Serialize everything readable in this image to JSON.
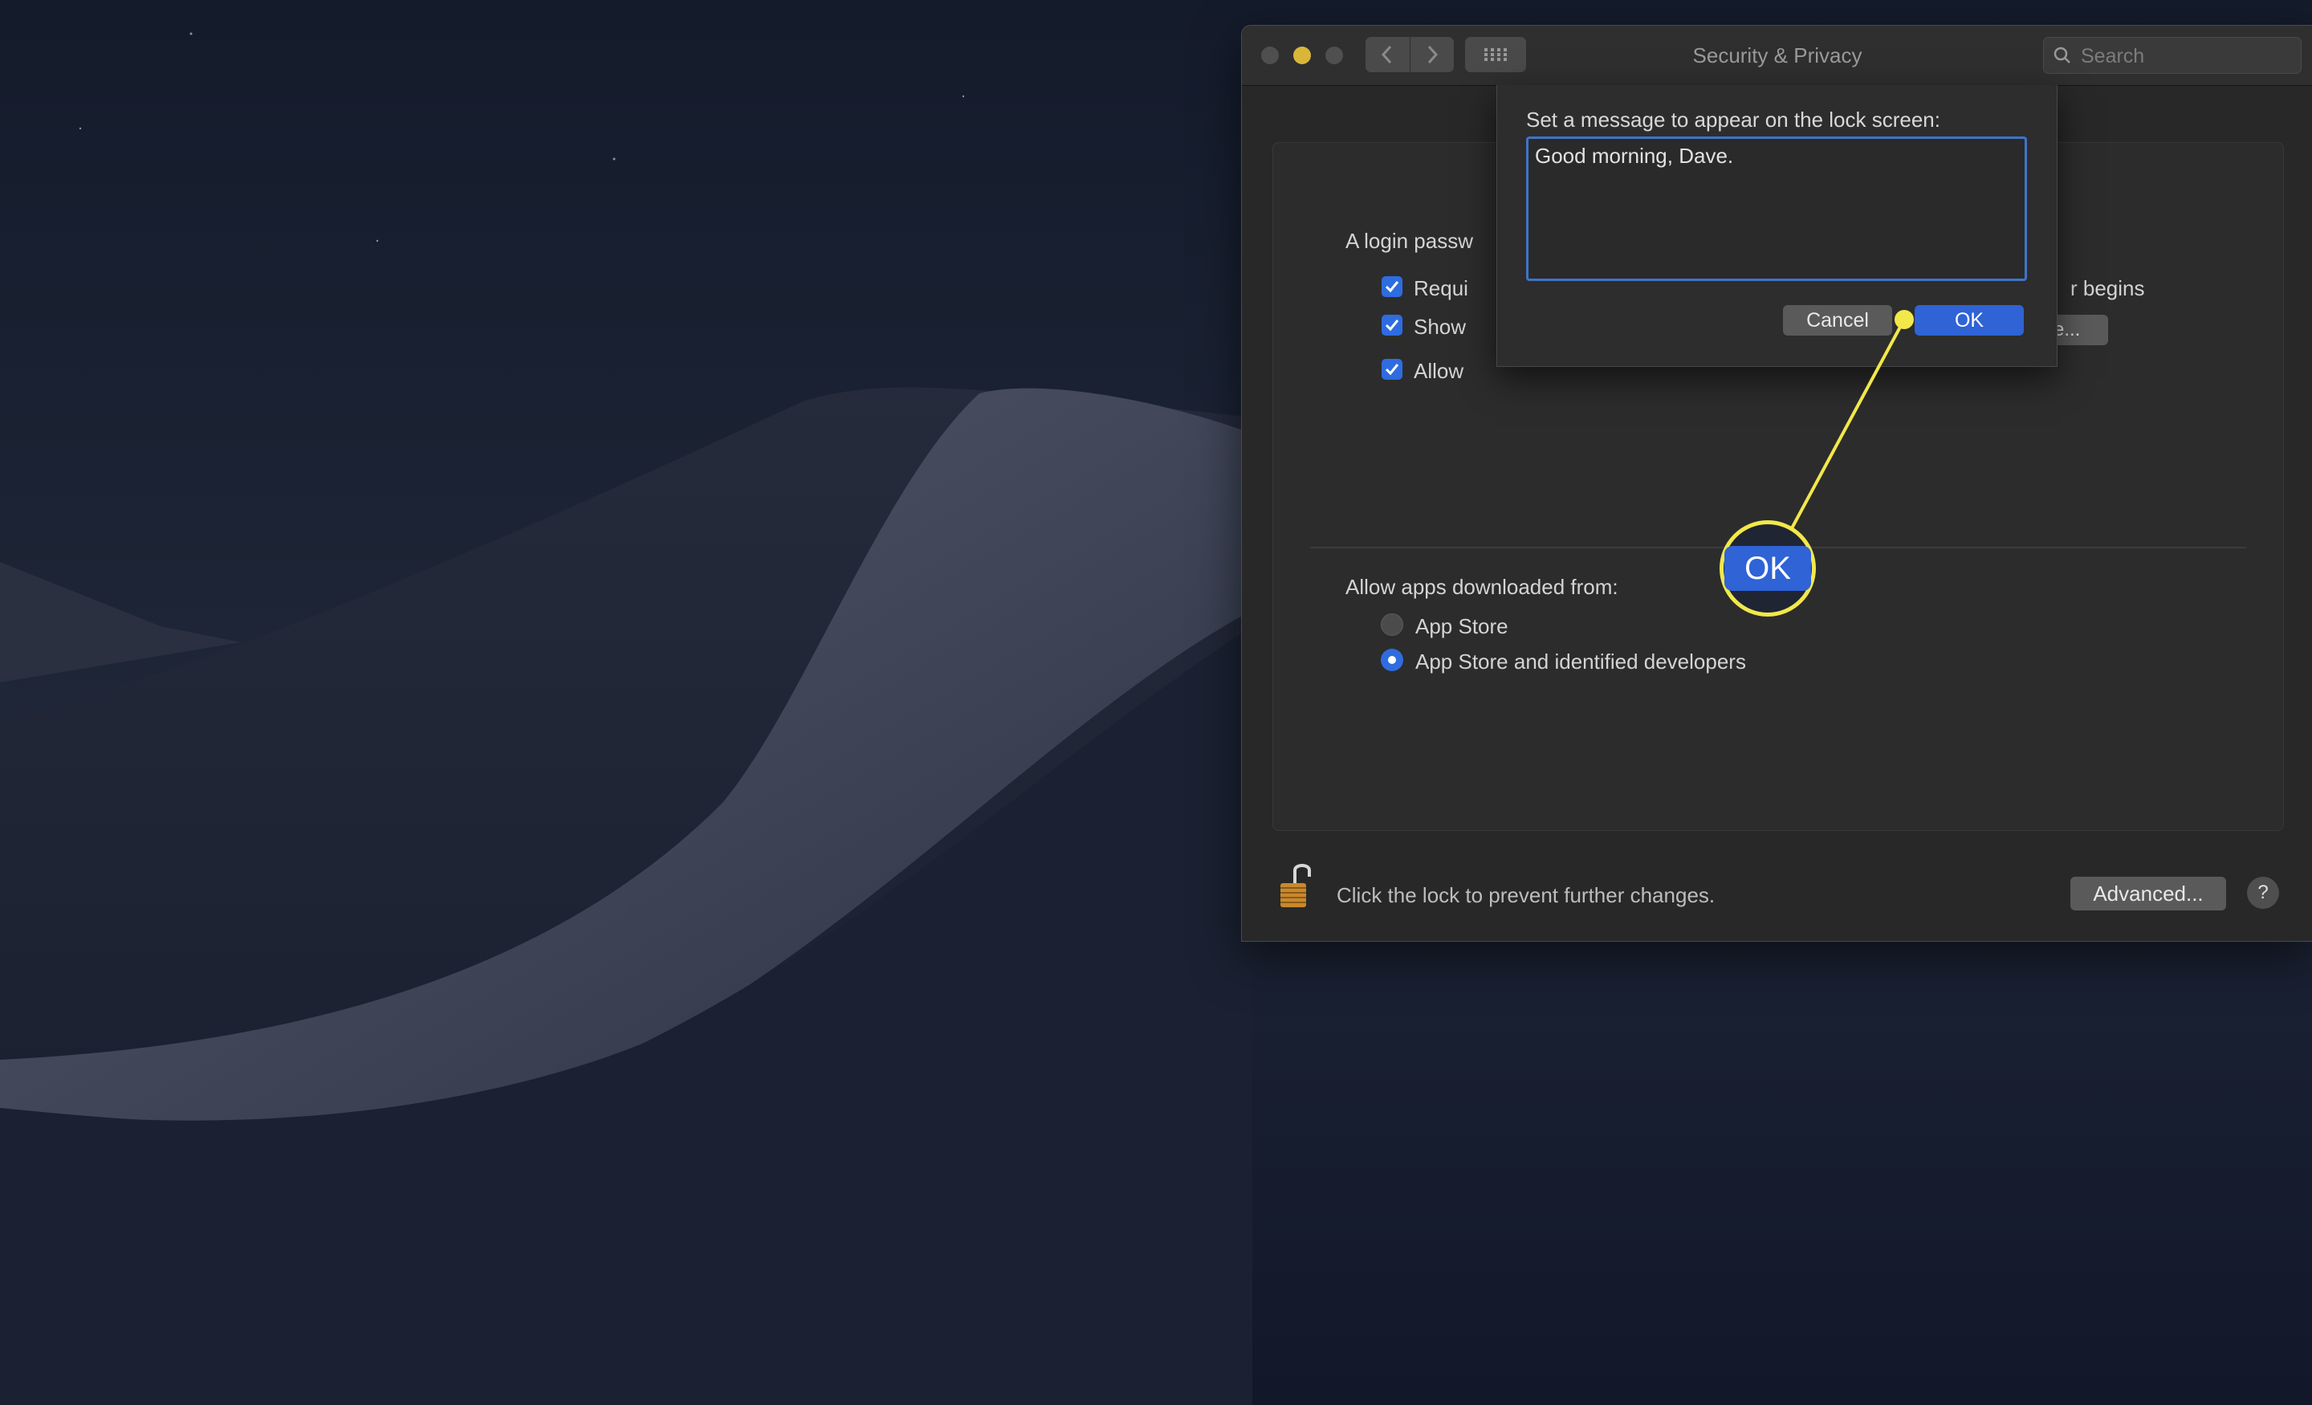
{
  "window": {
    "title": "Security & Privacy",
    "search_placeholder": "Search"
  },
  "general": {
    "password_text": "A login passw",
    "checkbox_require": "Requi",
    "checkbox_require_suffix": "r begins",
    "checkbox_show": "Show",
    "checkbox_allow": "Allow",
    "partial_button": "e..."
  },
  "apps": {
    "label": "Allow apps downloaded from:",
    "options": [
      "App Store",
      "App Store and identified developers"
    ],
    "selected": "App Store and identified developers"
  },
  "footer": {
    "lock_text": "Click the lock to prevent further changes.",
    "advanced_label": "Advanced...",
    "help_label": "?"
  },
  "dialog": {
    "label": "Set a message to appear on the lock screen:",
    "message": "Good morning, Dave.",
    "cancel_label": "Cancel",
    "ok_label": "OK"
  },
  "callout": {
    "label": "OK",
    "color": "#f2e84a"
  },
  "colors": {
    "accent": "#2f63d6",
    "checkbox": "#2f6ce0",
    "minimize": "#d9b63a"
  }
}
